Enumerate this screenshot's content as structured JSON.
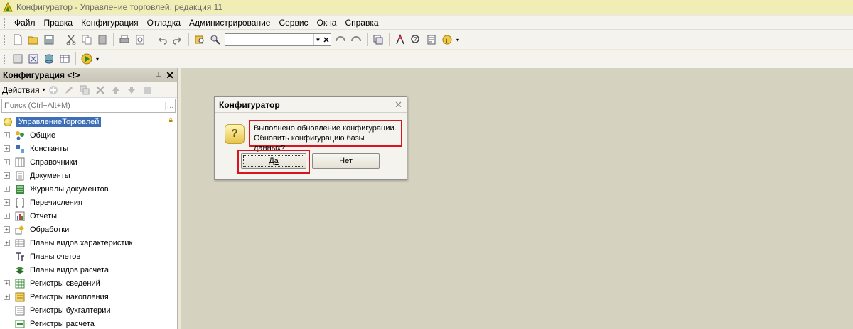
{
  "window": {
    "title": "Конфигуратор - Управление торговлей, редакция 11"
  },
  "menu": [
    {
      "label": "Файл",
      "u": "Ф"
    },
    {
      "label": "Правка",
      "u": "П"
    },
    {
      "label": "Конфигурация",
      "u": "К"
    },
    {
      "label": "Отладка",
      "u": "О"
    },
    {
      "label": "Администрирование",
      "u": "А"
    },
    {
      "label": "Сервис",
      "u": "С"
    },
    {
      "label": "Окна",
      "u": "О"
    },
    {
      "label": "Справка",
      "u": "С"
    }
  ],
  "panel": {
    "title": "Конфигурация <!>",
    "actions_label": "Действия",
    "search_placeholder": "Поиск (Ctrl+Alt+M)",
    "root": "УправлениеТорговлей",
    "items": [
      {
        "label": "Общие",
        "expandable": true,
        "icon": "common-icon"
      },
      {
        "label": "Константы",
        "expandable": true,
        "icon": "constants-icon"
      },
      {
        "label": "Справочники",
        "expandable": true,
        "icon": "catalogs-icon"
      },
      {
        "label": "Документы",
        "expandable": true,
        "icon": "documents-icon"
      },
      {
        "label": "Журналы документов",
        "expandable": true,
        "icon": "journals-icon"
      },
      {
        "label": "Перечисления",
        "expandable": true,
        "icon": "enums-icon"
      },
      {
        "label": "Отчеты",
        "expandable": true,
        "icon": "reports-icon"
      },
      {
        "label": "Обработки",
        "expandable": true,
        "icon": "processing-icon"
      },
      {
        "label": "Планы видов характеристик",
        "expandable": true,
        "icon": "char-types-icon"
      },
      {
        "label": "Планы счетов",
        "expandable": false,
        "icon": "chart-accounts-icon"
      },
      {
        "label": "Планы видов расчета",
        "expandable": false,
        "icon": "calc-types-icon"
      },
      {
        "label": "Регистры сведений",
        "expandable": true,
        "icon": "info-registers-icon"
      },
      {
        "label": "Регистры накопления",
        "expandable": true,
        "icon": "accum-registers-icon"
      },
      {
        "label": "Регистры бухгалтерии",
        "expandable": false,
        "icon": "acc-registers-icon"
      },
      {
        "label": "Регистры расчета",
        "expandable": false,
        "icon": "calc-registers-icon"
      }
    ]
  },
  "dialog": {
    "title": "Конфигуратор",
    "message_line1": "Выполнено обновление конфигурации.",
    "message_line2": "Обновить конфигурацию базы данных?",
    "yes": "Да",
    "no": "Нет"
  },
  "colors": {
    "highlight": "#d9141e",
    "selection": "#3d6fb8",
    "workspace": "#d6d2c0"
  }
}
